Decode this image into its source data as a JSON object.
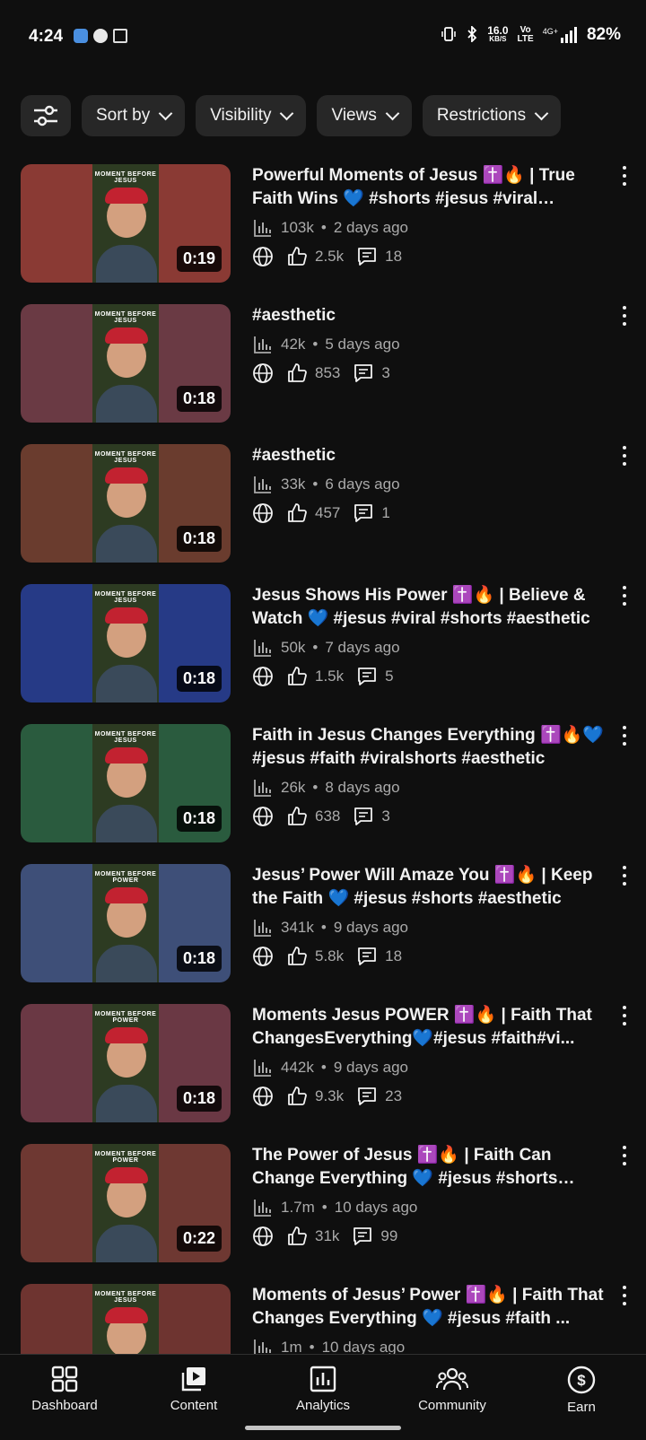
{
  "status_bar": {
    "time": "4:24",
    "net_speed": "16.0",
    "net_unit": "KB/S",
    "volte_top": "Vo",
    "volte_bottom": "LTE",
    "signal": "4G+",
    "battery": "82%"
  },
  "filters": {
    "chips": [
      {
        "label": "Sort by"
      },
      {
        "label": "Visibility"
      },
      {
        "label": "Views"
      },
      {
        "label": "Restrictions"
      }
    ]
  },
  "videos": [
    {
      "title": "Powerful Moments of Jesus ✝️🔥 | True Faith Wins 💙 #shorts #jesus #viral #aesthe...",
      "views": "103k",
      "age": "2 days ago",
      "likes": "2.5k",
      "comments": "18",
      "duration": "0:19",
      "thumb_color": "#8a3a34",
      "caption": "MOMENT BEFORE JESUS"
    },
    {
      "title": "#aesthetic",
      "views": "42k",
      "age": "5 days ago",
      "likes": "853",
      "comments": "3",
      "duration": "0:18",
      "thumb_color": "#6a3a44",
      "caption": "MOMENT BEFORE JESUS"
    },
    {
      "title": "#aesthetic",
      "views": "33k",
      "age": "6 days ago",
      "likes": "457",
      "comments": "1",
      "duration": "0:18",
      "thumb_color": "#6a3c2e",
      "caption": "MOMENT BEFORE JESUS"
    },
    {
      "title": "Jesus Shows His Power ✝️🔥 | Believe & Watch 💙 #jesus #viral #shorts #aesthetic",
      "views": "50k",
      "age": "7 days ago",
      "likes": "1.5k",
      "comments": "5",
      "duration": "0:18",
      "thumb_color": "#263a86",
      "caption": "MOMENT BEFORE JESUS"
    },
    {
      "title": "Faith in Jesus Changes Everything ✝️🔥💙 #jesus #faith #viralshorts #aesthetic",
      "views": "26k",
      "age": "8 days ago",
      "likes": "638",
      "comments": "3",
      "duration": "0:18",
      "thumb_color": "#2a5b3e",
      "caption": "MOMENT BEFORE JESUS"
    },
    {
      "title": "Jesus’ Power Will Amaze You ✝️🔥 | Keep the Faith 💙 #jesus #shorts #aesthetic",
      "views": "341k",
      "age": "9 days ago",
      "likes": "5.8k",
      "comments": "18",
      "duration": "0:18",
      "thumb_color": "#3e4f78",
      "caption": "MOMENT BEFORE POWER"
    },
    {
      "title": "Moments Jesus POWER ✝️🔥 | Faith That ChangesEverything💙#jesus #faith#vi...",
      "views": "442k",
      "age": "9 days ago",
      "likes": "9.3k",
      "comments": "23",
      "duration": "0:18",
      "thumb_color": "#6a3844",
      "caption": "MOMENT BEFORE POWER"
    },
    {
      "title": "The Power of Jesus ✝️🔥 | Faith Can Change Everything 💙 #jesus #shorts #viral...",
      "views": "1.7m",
      "age": "10 days ago",
      "likes": "31k",
      "comments": "99",
      "duration": "0:22",
      "thumb_color": "#6e3832",
      "caption": "MOMENT BEFORE POWER"
    },
    {
      "title": "Moments of Jesus’ Power ✝️🔥 | Faith That Changes Everything 💙 #jesus #faith ...",
      "views": "1m",
      "age": "10 days ago",
      "likes": "",
      "comments": "",
      "duration": "",
      "thumb_color": "#6e3430",
      "caption": "MOMENT BEFORE JESUS"
    }
  ],
  "nav": [
    {
      "label": "Dashboard",
      "icon": "dashboard-icon"
    },
    {
      "label": "Content",
      "icon": "content-icon"
    },
    {
      "label": "Analytics",
      "icon": "analytics-icon"
    },
    {
      "label": "Community",
      "icon": "community-icon"
    },
    {
      "label": "Earn",
      "icon": "earn-icon"
    }
  ]
}
